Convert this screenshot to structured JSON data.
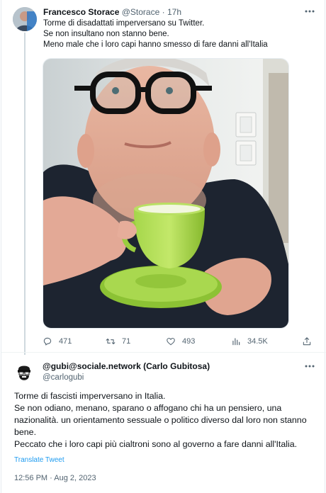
{
  "tweet1": {
    "name": "Francesco Storace",
    "handle": "@Storace",
    "dot": "·",
    "time": "17h",
    "lines": [
      "Torme di disadattati imperversano su Twitter.",
      "Se non insultano non stanno bene.",
      "Meno male che i loro capi hanno smesso di fare danni all'Italia"
    ],
    "actions": {
      "replies": "471",
      "retweets": "71",
      "likes": "493",
      "views": "34.5K"
    },
    "icons": [
      "reply-icon",
      "retweet-icon",
      "like-icon",
      "views-icon",
      "share-icon",
      "more-icon"
    ]
  },
  "tweet2": {
    "name": "@gubi@sociale.network (Carlo Gubitosa)",
    "handle": "@carlogubi",
    "paragraphs": [
      "Torme di fascisti imperversano in Italia.",
      "Se non odiano, menano, sparano o affogano chi ha un pensiero, una nazionalità. un orientamento sessuale o politico diverso dal loro non stanno bene.",
      "Peccato che i loro capi più cialtroni sono al governo a fare danni all'Italia."
    ],
    "translate": "Translate Tweet",
    "timestamp": "12:56 PM · Aug 2, 2023"
  },
  "colors": {
    "accent": "#1d9bf0",
    "secondary_text": "#536471",
    "cup_green": "#9acd3e"
  }
}
